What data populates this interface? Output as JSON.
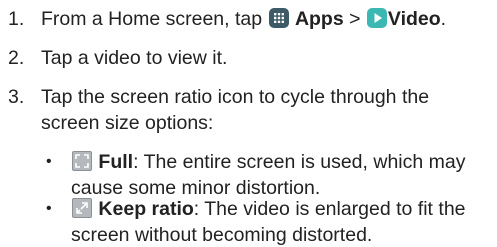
{
  "steps": [
    {
      "number": "1.",
      "prefix": "From a Home screen, tap",
      "apps_label": "Apps",
      "separator": ">",
      "video_label": "Video",
      "suffix": "."
    },
    {
      "number": "2.",
      "text": "Tap a video to view it."
    },
    {
      "number": "3.",
      "line1": "Tap the screen ratio icon to cycle through the",
      "line2": "screen size options:"
    }
  ],
  "options": [
    {
      "bullet": "•",
      "label": "Full",
      "desc_line1": ": The entire screen is used, which may",
      "desc_line2": "cause some minor distortion."
    },
    {
      "bullet": "•",
      "label": "Keep ratio",
      "desc_line1": ": The video is enlarged to fit the",
      "desc_line2": "screen without becoming distorted."
    }
  ],
  "icons": {
    "apps": "apps-grid-icon",
    "video": "video-play-icon",
    "full": "full-screen-icon",
    "keep_ratio": "keep-ratio-icon"
  },
  "colors": {
    "text": "#222222",
    "apps_icon_bg": "#3d5a66",
    "video_icon_bg": "#3bb8b2",
    "ratio_icon_bg": "#b5b9bd"
  }
}
